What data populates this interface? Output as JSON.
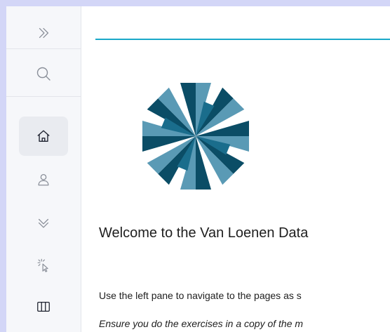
{
  "sidebar": {
    "items": [
      {
        "icon": "chevrons-right-icon"
      },
      {
        "icon": "search-icon"
      },
      {
        "icon": "home-icon",
        "active": true
      },
      {
        "icon": "user-icon"
      },
      {
        "icon": "chevrons-down-icon"
      },
      {
        "icon": "cursor-click-icon"
      },
      {
        "icon": "columns-icon"
      }
    ]
  },
  "main": {
    "welcome_heading": "Welcome to the Van Loenen Data",
    "paragraph1": "Use the left pane to navigate to the pages as s",
    "paragraph2": "Ensure you do the exercises in a copy of the m"
  },
  "colors": {
    "accent_line": "#1aa8c9",
    "logo_dark": "#0b4d66",
    "logo_mid": "#1a6d8c",
    "logo_light": "#5a9ab5"
  }
}
